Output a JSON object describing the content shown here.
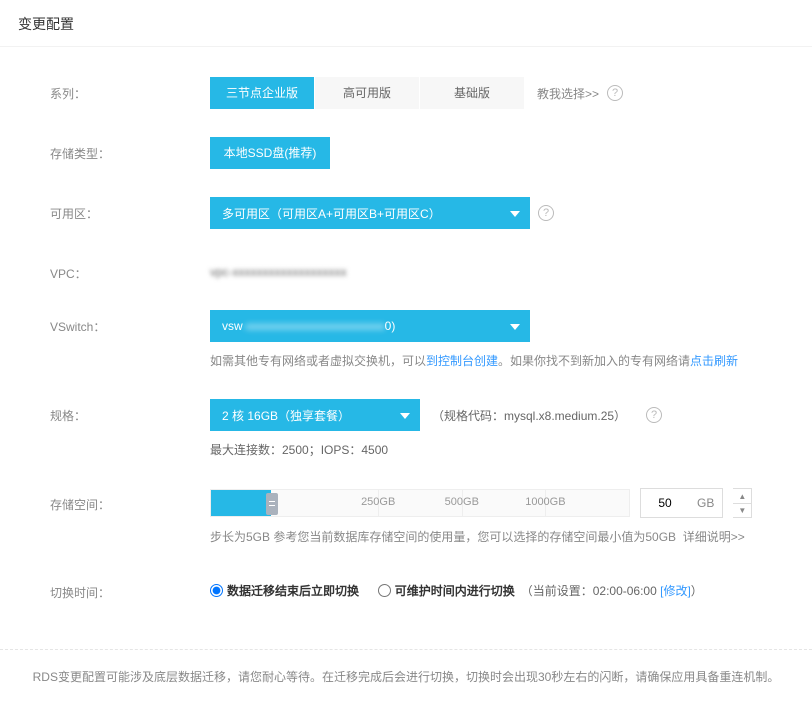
{
  "header": {
    "title": "变更配置"
  },
  "series": {
    "label": "系列：",
    "options": [
      "三节点企业版",
      "高可用版",
      "基础版"
    ],
    "help_link": "教我选择>>"
  },
  "storage_type": {
    "label": "存储类型：",
    "value": "本地SSD盘(推荐)"
  },
  "zone": {
    "label": "可用区：",
    "value": "多可用区（可用区A+可用区B+可用区C）"
  },
  "vpc": {
    "label": "VPC：",
    "value": "vpc-xxxxxxxxxxxxxxxxxxx"
  },
  "vswitch": {
    "label": "VSwitch：",
    "value": "vsw-xxxxxxxxxxxxxxxxxxxxxxx0)",
    "hint_prefix": "如需其他专有网络或者虚拟交换机，可以",
    "hint_link1": "到控制台创建",
    "hint_mid": "。如果你找不到新加入的专有网络请",
    "hint_link2": "点击刷新"
  },
  "spec": {
    "label": "规格：",
    "value": "2 核 16GB（独享套餐）",
    "code_label": "（规格代码：mysql.x8.medium.25）",
    "meta": "最大连接数：2500；IOPS：4500"
  },
  "storage": {
    "label": "存储空间：",
    "marks": [
      "250GB",
      "500GB",
      "1000GB"
    ],
    "value": "50",
    "unit": "GB",
    "hint": "步长为5GB  参考您当前数据库存储空间的使用量，您可以选择的存储空间最小值为50GB",
    "detail_link": "详细说明>>"
  },
  "switch_time": {
    "label": "切换时间：",
    "opt1": "数据迁移结束后立即切换",
    "opt2": "可维护时间内进行切换",
    "current_prefix": "（当前设置：",
    "current_value": "02:00-06:00",
    "modify": "[修改]",
    "suffix": "）"
  },
  "footer": {
    "text": "RDS变更配置可能涉及底层数据迁移，请您耐心等待。在迁移完成后会进行切换，切换时会出现30秒左右的闪断，请确保应用具备重连机制。"
  }
}
